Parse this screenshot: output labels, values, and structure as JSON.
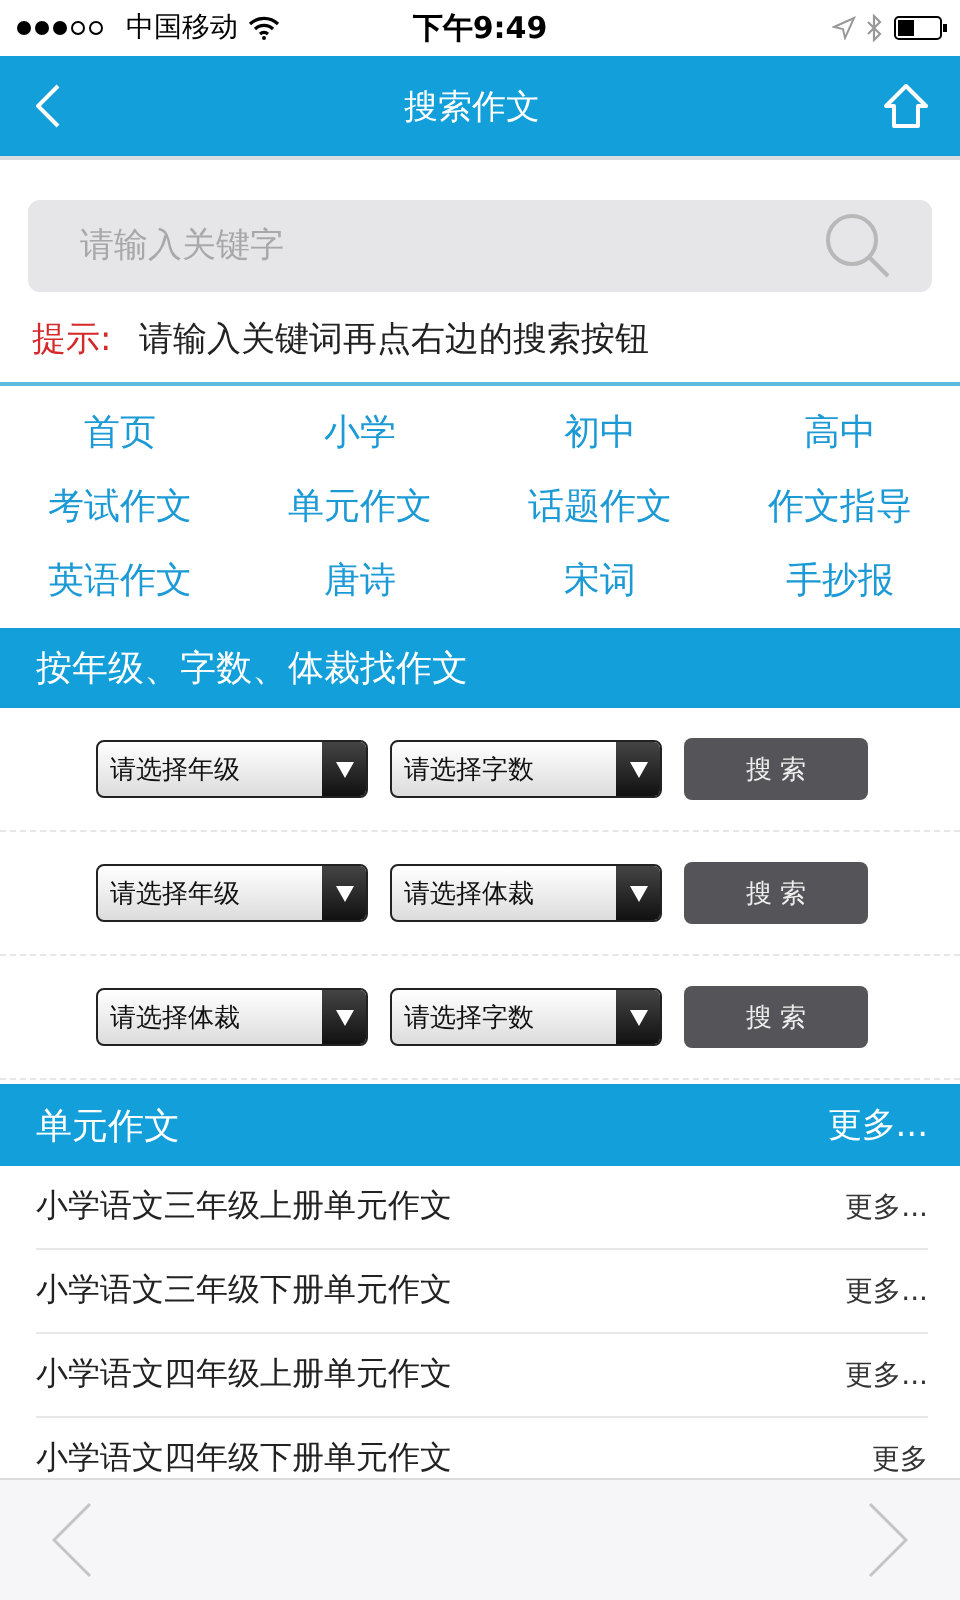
{
  "status_bar": {
    "carrier": "中国移动",
    "time": "下午9:49"
  },
  "nav_bar": {
    "title": "搜索作文"
  },
  "search": {
    "placeholder": "请输入关键字"
  },
  "hint": {
    "label": "提示:",
    "text": "请输入关键词再点右边的搜索按钮"
  },
  "category_links": [
    "首页",
    "小学",
    "初中",
    "高中",
    "考试作文",
    "单元作文",
    "话题作文",
    "作文指导",
    "英语作文",
    "唐诗",
    "宋词",
    "手抄报"
  ],
  "filter_section": {
    "title": "按年级、字数、体裁找作文",
    "rows": [
      {
        "selects": [
          "请选择年级",
          "请选择字数"
        ],
        "button": "搜 索"
      },
      {
        "selects": [
          "请选择年级",
          "请选择体裁"
        ],
        "button": "搜 索"
      },
      {
        "selects": [
          "请选择体裁",
          "请选择字数"
        ],
        "button": "搜 索"
      }
    ]
  },
  "unit_section": {
    "title": "单元作文",
    "more": "更多...",
    "items": [
      {
        "title": "小学语文三年级上册单元作文",
        "more": "更多..."
      },
      {
        "title": "小学语文三年级下册单元作文",
        "more": "更多..."
      },
      {
        "title": "小学语文四年级上册单元作文",
        "more": "更多..."
      },
      {
        "title": "小学语文四年级下册单元作文",
        "more": "更多"
      }
    ]
  }
}
